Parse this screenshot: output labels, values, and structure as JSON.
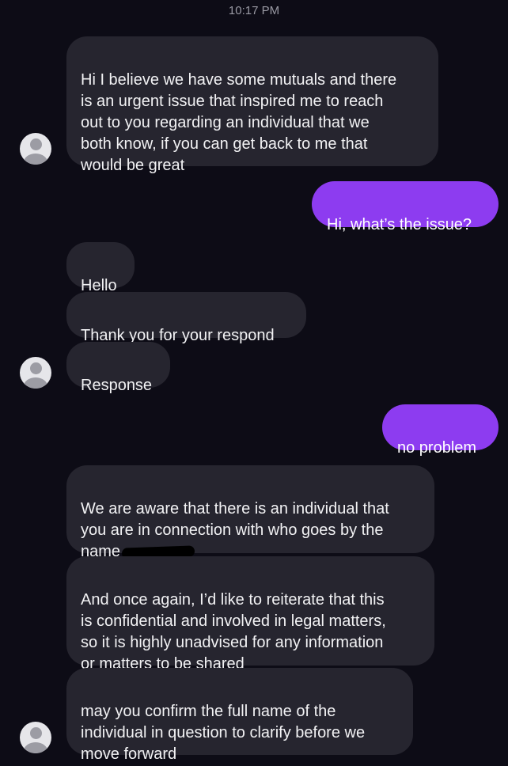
{
  "status": {
    "timestamp": "10:17 PM"
  },
  "messages": [
    {
      "id": "m1",
      "direction": "incoming",
      "text": "Hi I believe we have some mutuals and there\nis an urgent issue that inspired me to reach\nout to you regarding an individual that we\nboth know, if you can get back to me that\nwould be great"
    },
    {
      "id": "m2",
      "direction": "outgoing",
      "text": "Hi, what’s the issue?"
    },
    {
      "id": "m3",
      "direction": "incoming",
      "text": "Hello"
    },
    {
      "id": "m4",
      "direction": "incoming",
      "text": "Thank you for your respond"
    },
    {
      "id": "m5",
      "direction": "incoming",
      "text": "Response"
    },
    {
      "id": "m6",
      "direction": "outgoing",
      "text": "no problem"
    },
    {
      "id": "m7",
      "direction": "incoming",
      "text": "We are aware that there is an individual that\nyou are in connection with who goes by the",
      "text_tail": "name"
    },
    {
      "id": "m8",
      "direction": "incoming",
      "text": "And once again, I’d like to reiterate that this\nis confidential and involved in legal matters,\nso it is highly unadvised for any information\nor matters to be shared"
    },
    {
      "id": "m9",
      "direction": "incoming",
      "text": "may you confirm the full name of the\nindividual in question to clarify before we\nmove forward"
    }
  ],
  "colors": {
    "background": "#0d0c16",
    "incoming_bubble": "#26252f",
    "outgoing_bubble": "#8d3cf0",
    "timestamp": "#9a9aa4"
  },
  "icons": {
    "avatar": "default-profile-avatar-icon"
  }
}
